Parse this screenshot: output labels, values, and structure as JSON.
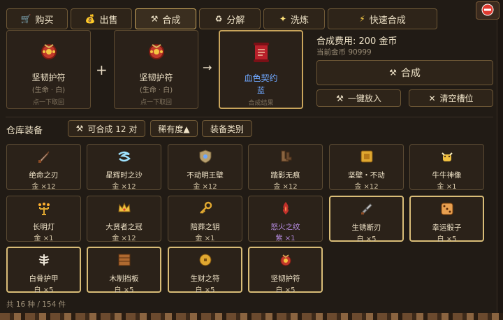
{
  "tabs": [
    {
      "label": "购买",
      "icon": "cart-icon"
    },
    {
      "label": "出售",
      "icon": "coin-bag-icon"
    },
    {
      "label": "合成",
      "icon": "crossed-hammers-icon"
    },
    {
      "label": "分解",
      "icon": "recycle-icon"
    },
    {
      "label": "洗炼",
      "icon": "sparkle-icon"
    }
  ],
  "quick_craft": {
    "label": "快速合成",
    "icon": "lightning-icon"
  },
  "close_icon": "close-circle-icon",
  "craft": {
    "slot1": {
      "name": "坚韧护符",
      "sub": "(生命 · 白)",
      "hint": "点一下取回"
    },
    "slot2": {
      "name": "坚韧护符",
      "sub": "(生命 · 白)",
      "hint": "点一下取回"
    },
    "plus": "+",
    "arrow": "→",
    "result": {
      "name": "血色契约",
      "quality": "蓝",
      "hint": "合成结果"
    },
    "cost_label": "合成费用: 200 金币",
    "current_gold": "当前金币 90999",
    "craft_button": "合成",
    "auto_fill_button": "一键放入",
    "clear_button": "清空槽位"
  },
  "warehouse": {
    "title": "仓库装备",
    "craftable_filter": "可合成 12 对",
    "rarity_sort": "稀有度▲",
    "category_filter": "装备类别",
    "footer": "共 16 种 / 154 件",
    "items": [
      {
        "name": "绝命之刃",
        "qty": "金 ×12",
        "icon": "dagger-icon",
        "tier": "gold"
      },
      {
        "name": "星辉时之沙",
        "qty": "金 ×12",
        "icon": "wind-swirl-icon",
        "tier": "gold"
      },
      {
        "name": "不动明王壁",
        "qty": "金 ×12",
        "icon": "shield-icon",
        "tier": "gold"
      },
      {
        "name": "踏影无痕",
        "qty": "金 ×12",
        "icon": "boots-icon",
        "tier": "gold"
      },
      {
        "name": "坚壁・不动",
        "qty": "金 ×12",
        "icon": "golden-shield-icon",
        "tier": "gold"
      },
      {
        "name": "牛牛神像",
        "qty": "金 ×1",
        "icon": "cow-statue-icon",
        "tier": "gold"
      },
      {
        "name": "长明灯",
        "qty": "金 ×1",
        "icon": "candelabra-icon",
        "tier": "gold"
      },
      {
        "name": "大贤者之冠",
        "qty": "金 ×12",
        "icon": "crown-icon",
        "tier": "gold"
      },
      {
        "name": "陪葬之钥",
        "qty": "金 ×1",
        "icon": "key-icon",
        "tier": "gold"
      },
      {
        "name": "怒火之纹",
        "qty": "紫 ×1",
        "icon": "flame-sigil-icon",
        "tier": "purple"
      },
      {
        "name": "生锈断刃",
        "qty": "白 ×5",
        "icon": "broken-sword-icon",
        "tier": "white"
      },
      {
        "name": "幸运骰子",
        "qty": "白 ×5",
        "icon": "dice-icon",
        "tier": "white"
      },
      {
        "name": "白骨护甲",
        "qty": "白 ×5",
        "icon": "ribcage-icon",
        "tier": "white"
      },
      {
        "name": "木制挡板",
        "qty": "白 ×5",
        "icon": "wooden-board-icon",
        "tier": "white"
      },
      {
        "name": "生财之符",
        "qty": "白 ×5",
        "icon": "coin-charm-icon",
        "tier": "white"
      },
      {
        "name": "坚韧护符",
        "qty": "白 ×5",
        "icon": "amulet-icon",
        "tier": "white"
      }
    ]
  },
  "colors": {
    "accent_gold": "#c9a55c",
    "rare_blue": "#6fa8ff",
    "epic_purple": "#b58be0"
  }
}
